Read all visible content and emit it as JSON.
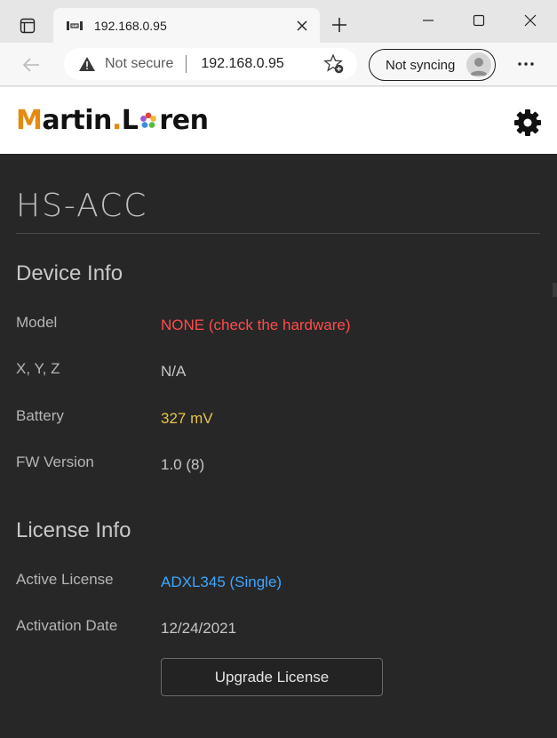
{
  "browser": {
    "tab": {
      "title": "192.168.0.95",
      "favicon": "hs-favicon"
    },
    "address": {
      "security_label": "Not secure",
      "url": "192.168.0.95"
    },
    "sync": {
      "label": "Not syncing"
    }
  },
  "site": {
    "logo": {
      "part1": "M",
      "part2": "artin",
      "part3": ".",
      "part4": "L",
      "part5": "ren"
    },
    "title": "HS-ACC"
  },
  "device_info": {
    "heading": "Device Info",
    "rows": [
      {
        "label": "Model",
        "value": "NONE (check the hardware)"
      },
      {
        "label": "X, Y, Z",
        "value": "N/A"
      },
      {
        "label": "Battery",
        "value": "327 mV"
      },
      {
        "label": "FW Version",
        "value": "1.0 (8)"
      }
    ]
  },
  "license_info": {
    "heading": "License Info",
    "rows": [
      {
        "label": "Active License",
        "value": "ADXL345 (Single)"
      },
      {
        "label": "Activation Date",
        "value": "12/24/2021"
      }
    ],
    "upgrade_label": "Upgrade License"
  },
  "colors": {
    "error": "#ff4c4c",
    "warning": "#e6c34a",
    "link": "#3ea6ff",
    "brand_orange": "#e58a0f",
    "page_bg": "#272727"
  }
}
